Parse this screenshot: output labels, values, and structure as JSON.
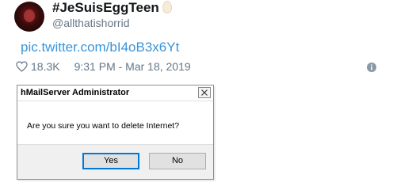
{
  "tweet": {
    "display_name": "#JeSuisEggTeen",
    "handle": "@allthatishorrid",
    "link_text": "pic.twitter.com/bI4oB3x6Yt",
    "likes": "18.3K",
    "timestamp": "9:31 PM - Mar 18, 2019",
    "icons": {
      "avatar": "avatar",
      "egg": "egg-emoji-icon",
      "heart": "heart-icon",
      "info": "info-icon"
    }
  },
  "dialog": {
    "title": "hMailServer Administrator",
    "message": "Are you sure you want to delete Internet?",
    "buttons": {
      "yes": "Yes",
      "no": "No"
    },
    "close_icon": "close-icon"
  },
  "colors": {
    "link": "#3b94d9",
    "muted": "#657786",
    "text": "#14171a",
    "dialog_focus": "#0078d7"
  }
}
